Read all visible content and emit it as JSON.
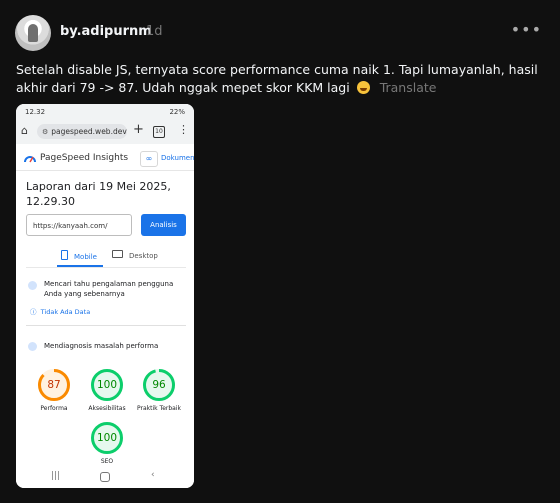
{
  "post": {
    "username": "by.adipurnm",
    "time": "1d",
    "text": "Setelah disable JS, ternyata score performance cuma naik 1. Tapi lumayanlah, hasil akhir dari 79 -> 87. Udah nggak mepet skor KKM lagi",
    "translate_label": "Translate"
  },
  "phone": {
    "status_time": "12.32",
    "status_right": "22%",
    "browser_url": "pagespeed.web.dev",
    "tab_count": "10",
    "psi": {
      "title": "PageSpeed Insights",
      "docs_label": "Dokumen"
    },
    "report_title": "Laporan dari 19 Mei 2025, 12.29.30",
    "url_input": "https://kanyaah.com/",
    "analyze_label": "Analisis",
    "tabs": {
      "mobile": "Mobile",
      "desktop": "Desktop"
    },
    "ux_text": "Mencari tahu pengalaman pengguna Anda yang sebenarnya",
    "no_data": "Tidak Ada Data",
    "diagnose_text": "Mendiagnosis masalah performa",
    "scores": [
      {
        "label": "Performa",
        "value": "87",
        "color": "#fa8a00",
        "track": "#fff2e0",
        "text_color": "#c33300"
      },
      {
        "label": "Aksesibilitas",
        "value": "100",
        "color": "#0cce6b",
        "track": "#e6f8ee",
        "text_color": "#008800"
      },
      {
        "label": "Praktik Terbaik",
        "value": "96",
        "color": "#0cce6b",
        "track": "#e6f8ee",
        "text_color": "#008800"
      },
      {
        "label": "SEO",
        "value": "100",
        "color": "#0cce6b",
        "track": "#e6f8ee",
        "text_color": "#008800"
      }
    ]
  },
  "icons": [
    "home-icon",
    "more-icon",
    "share-icon",
    "menu-icon",
    "tabs-icon",
    "plus-icon",
    "psi-logo-icon",
    "mobile-icon",
    "desktop-icon",
    "ux-icon",
    "diagnose-icon",
    "nav-recents-icon",
    "nav-home-icon",
    "nav-back-icon"
  ]
}
